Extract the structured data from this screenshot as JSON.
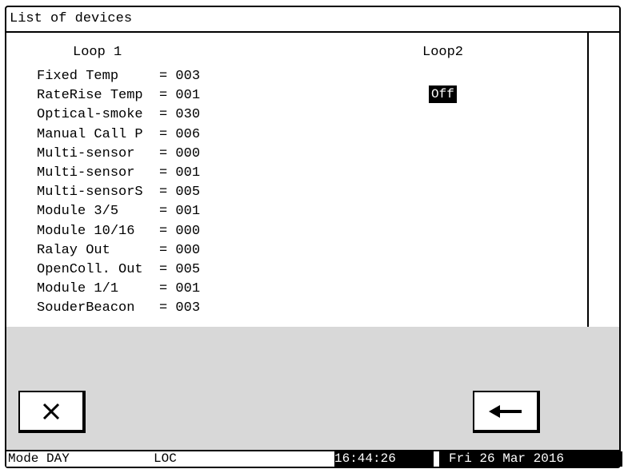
{
  "window": {
    "title": "List of devices"
  },
  "loop1": {
    "label": "Loop 1",
    "devices": [
      "Fixed Temp     = 003",
      "RateRise Temp  = 001",
      "Optical-smoke  = 030",
      "Manual Call P  = 006",
      "Multi-sensor   = 000",
      "Multi-sensor   = 001",
      "Multi-sensorS  = 005",
      "Module 3/5     = 001",
      "Module 10/16   = 000",
      "Ralay Out      = 000",
      "OpenColl. Out  = 005",
      "Module 1/1     = 001",
      "SouderBeacon   = 003"
    ]
  },
  "loop2": {
    "label": "Loop2",
    "state": "Off"
  },
  "buttons": {
    "close_icon": "close-x-icon",
    "back_icon": "left-arrow-icon"
  },
  "status": {
    "mode": "Mode DAY",
    "location": "LOC",
    "time": "16:44:26",
    "date": "Fri 26 Mar 2016"
  }
}
